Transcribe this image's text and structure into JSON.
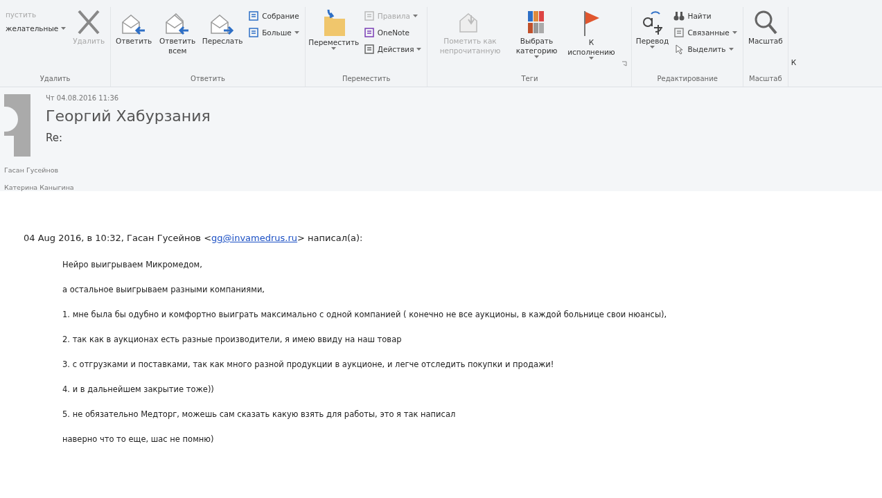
{
  "ribbon": {
    "groups": [
      {
        "label": "Удалить",
        "small": [
          {
            "text": "пустить",
            "disabled": true,
            "dropdown": false
          },
          {
            "text": "желательные",
            "disabled": false,
            "dropdown": true
          }
        ],
        "large": [
          {
            "text": "Удалить",
            "disabled": true,
            "dropdown": false
          }
        ]
      },
      {
        "label": "Ответить",
        "large": [
          {
            "text": "Ответить",
            "disabled": false,
            "dropdown": false
          },
          {
            "text": "Ответить всем",
            "disabled": false,
            "dropdown": false
          },
          {
            "text": "Переслать",
            "disabled": false,
            "dropdown": false
          }
        ],
        "small": [
          {
            "text": "Собрание",
            "disabled": false,
            "dropdown": false
          },
          {
            "text": "Больше",
            "disabled": false,
            "dropdown": true
          }
        ]
      },
      {
        "label": "Переместить",
        "large": [
          {
            "text": "Переместить",
            "disabled": false,
            "dropdown": true
          }
        ],
        "small": [
          {
            "text": "Правила",
            "disabled": true,
            "dropdown": true
          },
          {
            "text": "OneNote",
            "disabled": false,
            "dropdown": false
          },
          {
            "text": "Действия",
            "disabled": false,
            "dropdown": true
          }
        ]
      },
      {
        "label": "Теги",
        "large": [
          {
            "text": "Пометить как непрочитанную",
            "disabled": true,
            "dropdown": false
          },
          {
            "text": "Выбрать категорию",
            "disabled": false,
            "dropdown": true
          },
          {
            "text": "К исполнению",
            "disabled": false,
            "dropdown": true
          }
        ]
      },
      {
        "label": "Редактирование",
        "large": [
          {
            "text": "Перевод",
            "disabled": false,
            "dropdown": true
          }
        ],
        "small": [
          {
            "text": "Найти",
            "disabled": false,
            "dropdown": false
          },
          {
            "text": "Связанные",
            "disabled": false,
            "dropdown": true
          },
          {
            "text": "Выделить",
            "disabled": false,
            "dropdown": true
          }
        ]
      },
      {
        "label": "Масштаб",
        "large": [
          {
            "text": "Масштаб",
            "disabled": false,
            "dropdown": false
          }
        ]
      }
    ],
    "cut_label": "К"
  },
  "message": {
    "date": "Чт 04.08.2016 11:36",
    "sender": "Георгий Хабурзания",
    "subject": "Re:",
    "recipients": [
      "Гасан Гусейнов",
      "Катерина Каныгина"
    ]
  },
  "body": {
    "quote_header": {
      "before": "04 Aug 2016, в 10:32, Гасан Гусейнов <",
      "link": "gg@invamedrus.ru",
      "after": "> написал(а):"
    },
    "lines": [
      "Нейро выигрываем Микромедом,",
      "а остальное выигрываем разными компаниями,",
      "1. мне была бы одубно и комфортно выиграть максимально с одной компанией ( конечно не все аукционы, в каждой больнице свои нюансы),",
      "2. так как в аукционах есть разные производители, я имею ввиду на наш товар",
      "3. с отгрузками и поставками, так как много разной продукции в аукционе, и легче отследить покупки и продажи!",
      "4. и в дальнейшем закрытие тоже))",
      "5. не обязательно Медторг, можешь сам сказать какую взять для работы, это я так написал",
      "наверно что то еще, шас не помню)"
    ]
  }
}
